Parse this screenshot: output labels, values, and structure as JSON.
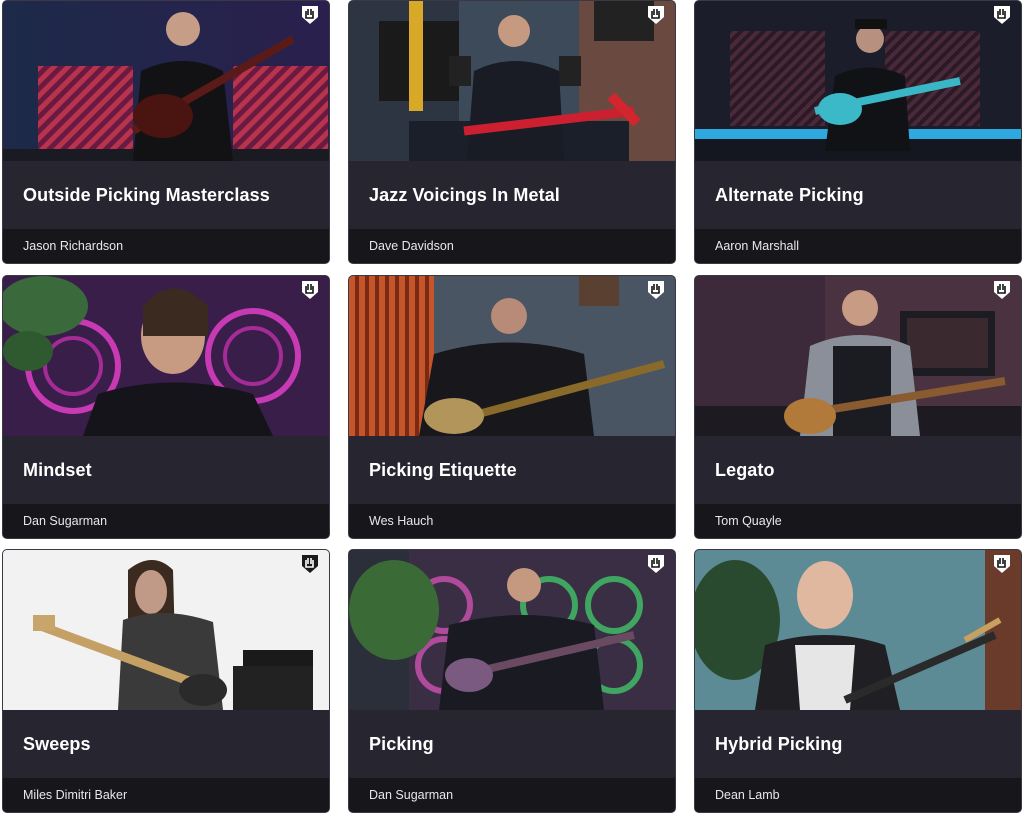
{
  "courses": [
    {
      "title": "Outside Picking Masterclass",
      "author": "Jason Richardson",
      "badge_icon": "rock-hand-icon"
    },
    {
      "title": "Jazz Voicings In Metal",
      "author": "Dave Davidson",
      "badge_icon": "rock-hand-icon"
    },
    {
      "title": "Alternate Picking",
      "author": "Aaron Marshall",
      "badge_icon": "rock-hand-icon"
    },
    {
      "title": "Mindset",
      "author": "Dan Sugarman",
      "badge_icon": "rock-hand-icon"
    },
    {
      "title": "Picking Etiquette",
      "author": "Wes Hauch",
      "badge_icon": "rock-hand-icon"
    },
    {
      "title": "Legato",
      "author": "Tom Quayle",
      "badge_icon": "rock-hand-icon"
    },
    {
      "title": "Sweeps",
      "author": "Miles Dimitri Baker",
      "badge_icon": "rock-hand-icon"
    },
    {
      "title": "Picking",
      "author": "Dan Sugarman",
      "badge_icon": "rock-hand-icon"
    },
    {
      "title": "Hybrid Picking",
      "author": "Dean Lamb",
      "badge_icon": "rock-hand-icon"
    }
  ],
  "colors": {
    "card_bg": "#262530",
    "author_bar_bg": "#16161b",
    "title_text": "#ffffff"
  }
}
